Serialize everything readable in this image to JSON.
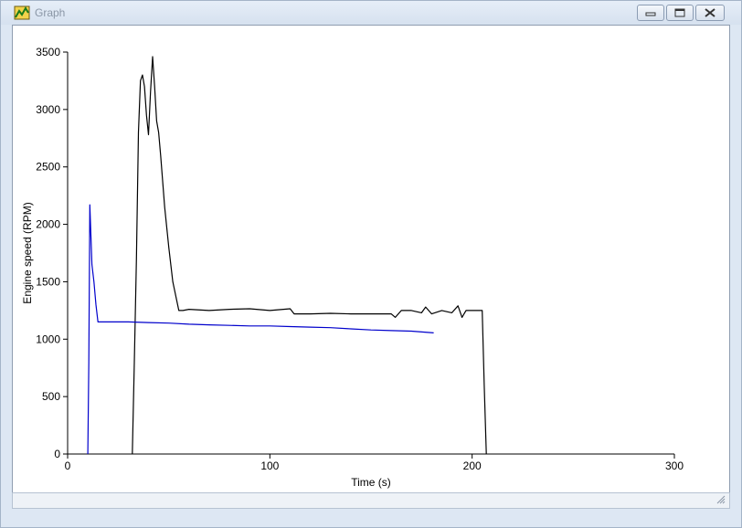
{
  "window": {
    "title": "Graph"
  },
  "icons": {
    "app": "graph-app-icon",
    "minimize": "minimize-icon",
    "restore": "restore-icon",
    "close": "close-icon",
    "grip": "resize-grip-icon"
  },
  "chart_data": {
    "type": "line",
    "title": "",
    "xlabel": "Time (s)",
    "ylabel": "Engine speed (RPM)",
    "xlim": [
      0,
      300
    ],
    "ylim": [
      0,
      3500
    ],
    "xticks": [
      0,
      100,
      200,
      300
    ],
    "yticks": [
      0,
      500,
      1000,
      1500,
      2000,
      2500,
      3000,
      3500
    ],
    "grid": false,
    "legend": "none",
    "series": [
      {
        "color": "#000000",
        "x": [
          32,
          33,
          34,
          35,
          36,
          37,
          38,
          39,
          40,
          41,
          42,
          43,
          44,
          45,
          46,
          48,
          50,
          52,
          55,
          57,
          60,
          70,
          80,
          90,
          100,
          110,
          112,
          120,
          130,
          140,
          150,
          160,
          162,
          165,
          170,
          175,
          177,
          180,
          185,
          190,
          193,
          195,
          197,
          200,
          205,
          206,
          207
        ],
        "y": [
          0,
          800,
          1700,
          2800,
          3250,
          3300,
          3200,
          2950,
          2780,
          3150,
          3460,
          3200,
          2900,
          2800,
          2600,
          2150,
          1800,
          1500,
          1250,
          1250,
          1260,
          1250,
          1260,
          1265,
          1250,
          1265,
          1220,
          1220,
          1225,
          1220,
          1220,
          1220,
          1190,
          1250,
          1250,
          1230,
          1280,
          1220,
          1250,
          1230,
          1290,
          1190,
          1250,
          1250,
          1250,
          600,
          0
        ]
      },
      {
        "color": "#0000cc",
        "x": [
          10,
          10.5,
          11,
          11.5,
          12,
          13,
          14,
          15,
          20,
          30,
          40,
          50,
          60,
          70,
          80,
          90,
          100,
          110,
          120,
          130,
          140,
          150,
          160,
          170,
          181
        ],
        "y": [
          0,
          800,
          2170,
          1900,
          1650,
          1500,
          1300,
          1150,
          1150,
          1150,
          1145,
          1140,
          1130,
          1125,
          1120,
          1115,
          1115,
          1110,
          1105,
          1100,
          1090,
          1080,
          1075,
          1070,
          1055
        ]
      }
    ]
  }
}
